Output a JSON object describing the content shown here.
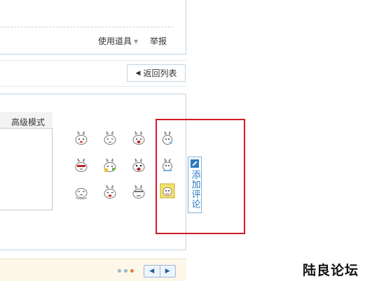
{
  "post_actions": {
    "use_tools_label": "使用道具",
    "report_label": "举报"
  },
  "navigation": {
    "back_to_list_label": "返回列表"
  },
  "editor": {
    "advanced_mode_label": "高级模式"
  },
  "smilies": [
    "smiley-1",
    "smiley-2",
    "smiley-3",
    "smiley-4",
    "smiley-5",
    "smiley-6",
    "smiley-7",
    "smiley-8",
    "smiley-9",
    "smiley-10",
    "smiley-11",
    "smiley-12"
  ],
  "add_comment": {
    "label": "添加评论",
    "icon": "pencil-icon"
  },
  "pager": {
    "prev_icon": "triangle-left-icon",
    "next_icon": "triangle-right-icon"
  },
  "watermark": "陆良论坛",
  "colors": {
    "highlight_border": "#cf1b24",
    "link_blue": "#2a78c2",
    "panel_border": "#c2d5e3",
    "bottom_strip": "#fdf7ea"
  }
}
